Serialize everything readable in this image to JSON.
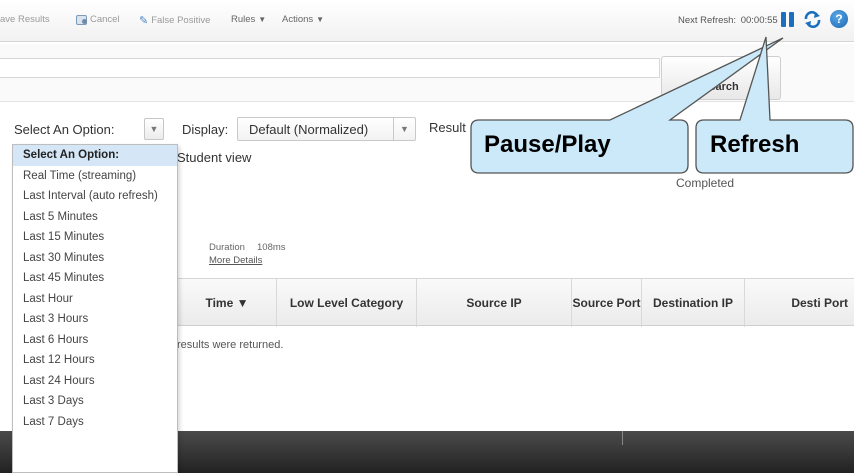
{
  "toolbar": {
    "save_results": "ave Results",
    "cancel": "Cancel",
    "false_positive": "False Positive",
    "rules": "Rules",
    "actions": "Actions",
    "next_refresh_label": "Next Refresh:",
    "next_refresh_time": "00:00:55"
  },
  "search": {
    "button_label": "Search",
    "input_value": ""
  },
  "options": {
    "time_select_value": "Select An Option:",
    "display_label": "Display:",
    "display_value": "Default (Normalized)",
    "results_label": "Result",
    "student_view": "Student view",
    "status": "Completed"
  },
  "duration": {
    "label": "Duration",
    "value": "108ms",
    "more_details": "More Details"
  },
  "table": {
    "columns": [
      "Time ▼",
      "Low Level Category",
      "Source IP",
      "Source Port",
      "Destination IP",
      "Desti Port"
    ],
    "empty_message": "results were returned."
  },
  "time_options": [
    "Select An Option:",
    "Real Time (streaming)",
    "Last Interval (auto refresh)",
    "Last 5 Minutes",
    "Last 15 Minutes",
    "Last 30 Minutes",
    "Last 45 Minutes",
    "Last Hour",
    "Last 3 Hours",
    "Last 6 Hours",
    "Last 12 Hours",
    "Last 24 Hours",
    "Last 3 Days",
    "Last 7 Days"
  ],
  "callouts": {
    "pause_play": "Pause/Play",
    "refresh": "Refresh"
  },
  "colors": {
    "accent": "#1c6fbf",
    "callout_fill": "#cbe9f8",
    "selected_row": "#d5e6f6"
  },
  "icons": [
    "cancel-icon",
    "false-positive-icon",
    "pause-icon",
    "refresh-icon",
    "help-icon"
  ]
}
